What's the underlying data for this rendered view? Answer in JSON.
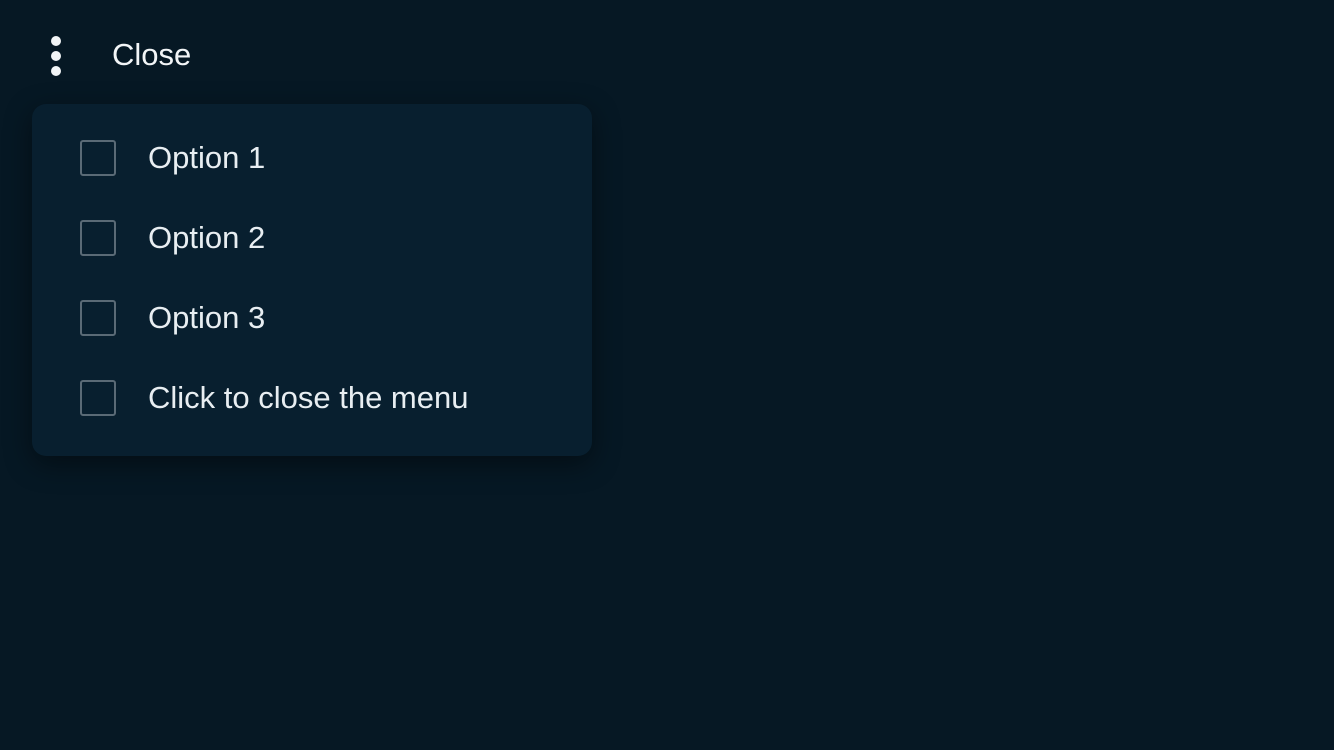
{
  "topbar": {
    "menu_icon": "vertical-dots-icon",
    "close_label": "Close"
  },
  "menu": {
    "items": [
      {
        "label": "Option 1",
        "checked": false
      },
      {
        "label": "Option 2",
        "checked": false
      },
      {
        "label": "Option 3",
        "checked": false
      },
      {
        "label": "Click to close the menu",
        "checked": false
      }
    ]
  },
  "colors": {
    "background": "#061824",
    "menu_surface": "#081f2f",
    "text": "#e8eef2",
    "checkbox_border": "#5a6a76"
  }
}
